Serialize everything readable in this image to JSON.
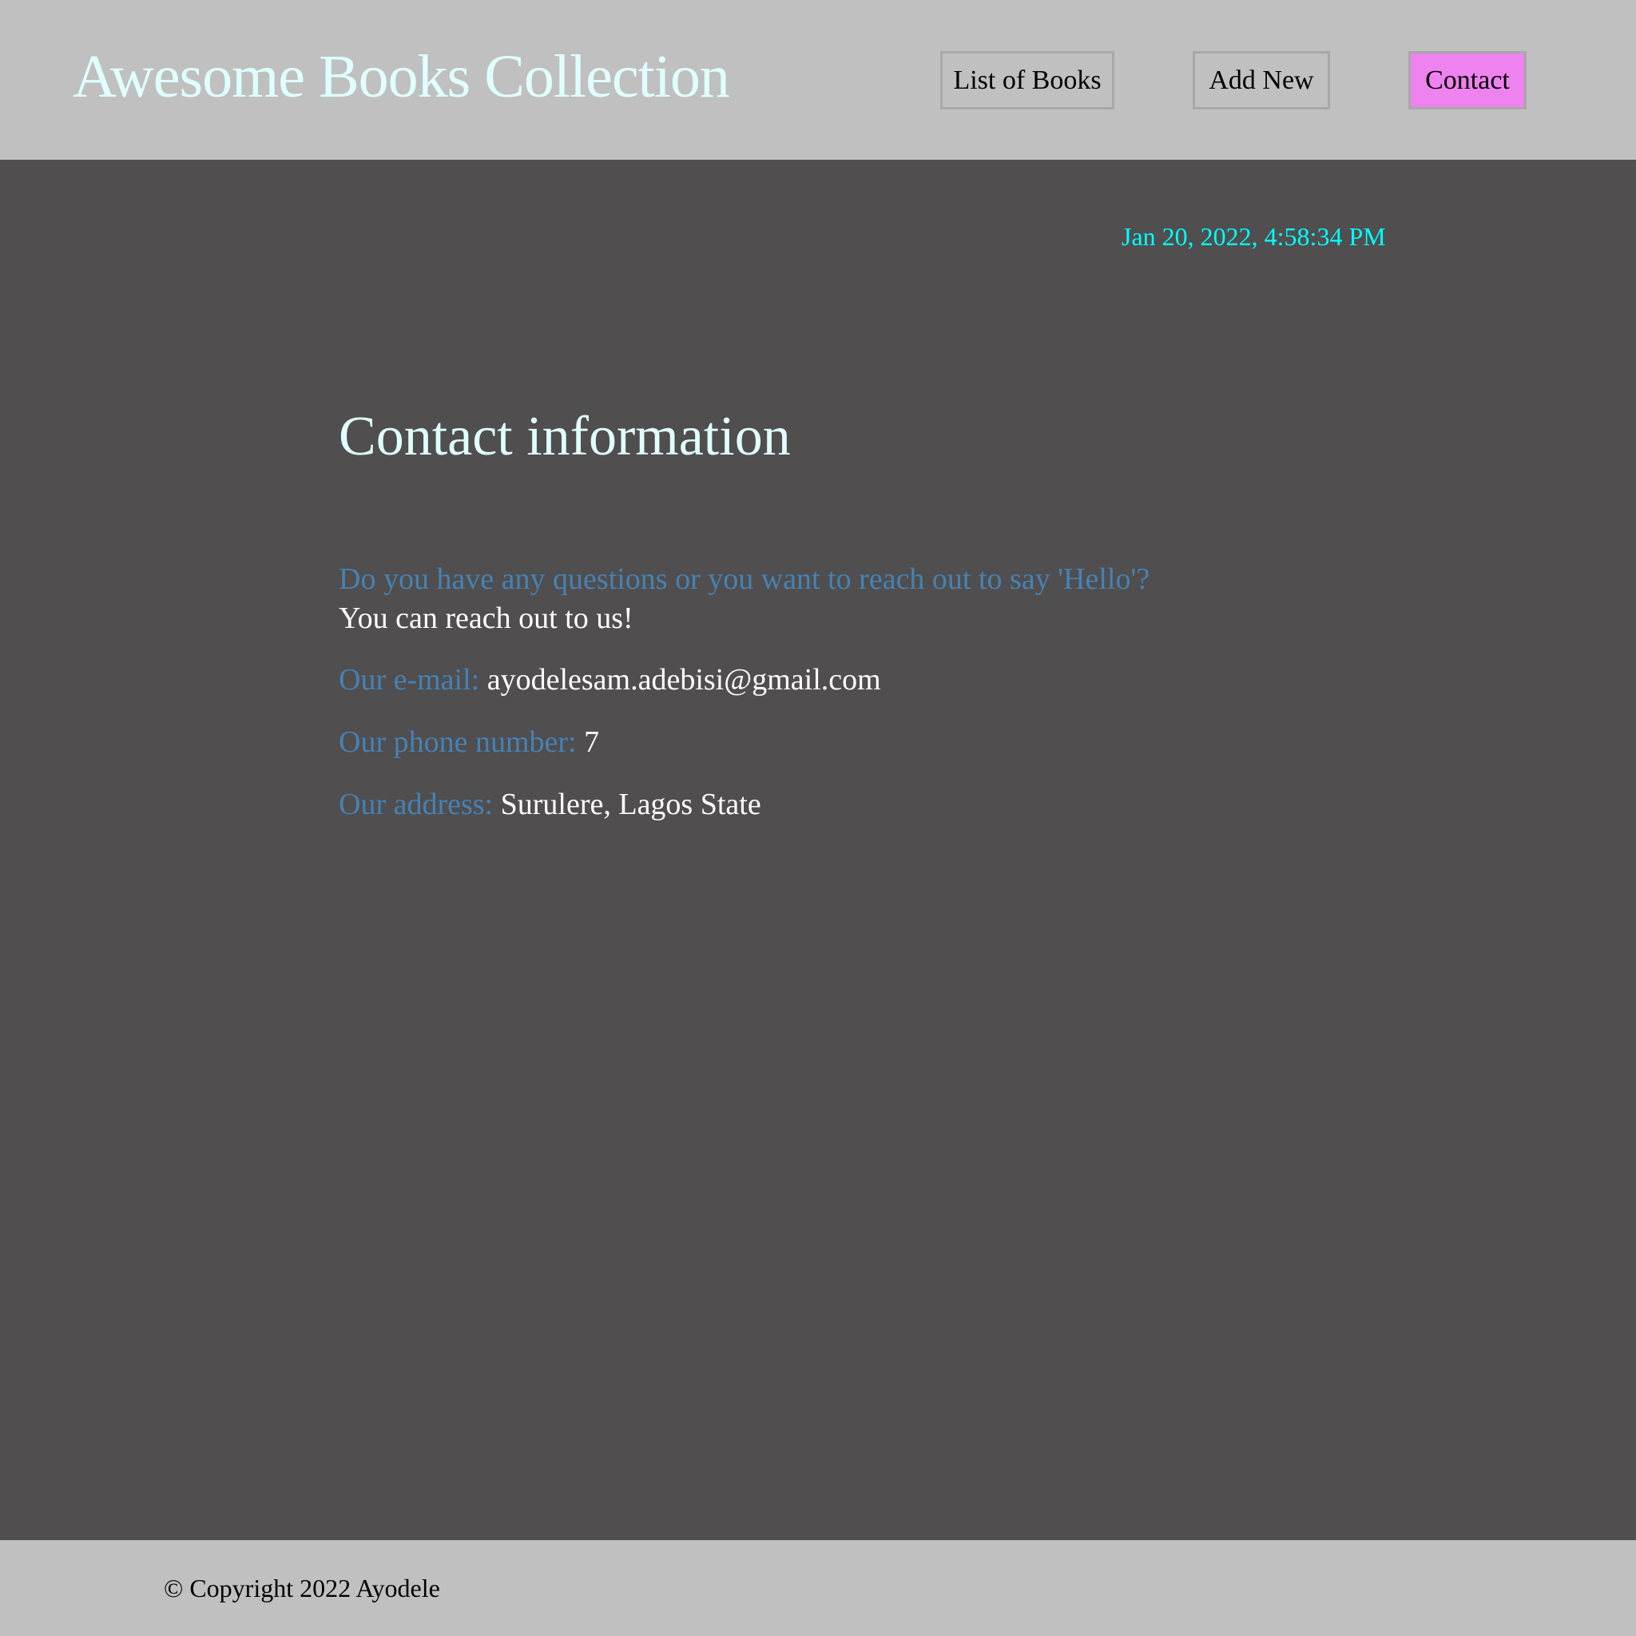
{
  "header": {
    "title": "Awesome Books Collection",
    "nav": [
      {
        "label": "List of Books",
        "active": false
      },
      {
        "label": "Add New",
        "active": false
      },
      {
        "label": "Contact",
        "active": true
      }
    ]
  },
  "main": {
    "datetime": "Jan 20, 2022, 4:58:34 PM",
    "heading": "Contact information",
    "question": "Do you have any questions or you want to reach out to say 'Hello'?",
    "reach": "You can reach out to us!",
    "email_label": "Our e-mail:",
    "email": "ayodelesam.adebisi@gmail.com",
    "phone_label": "Our phone number:",
    "phone": "7",
    "address_label": "Our address:",
    "address": "Surulere, Lagos State"
  },
  "footer": {
    "copyright": "© Copyright 2022 Ayodele"
  },
  "colors": {
    "header_bg": "#c0c0c0",
    "main_bg": "#504e4f",
    "active_nav": "#ee82ee",
    "label": "#4682b4",
    "date": "#00ffff",
    "title": "#e0ffff"
  }
}
